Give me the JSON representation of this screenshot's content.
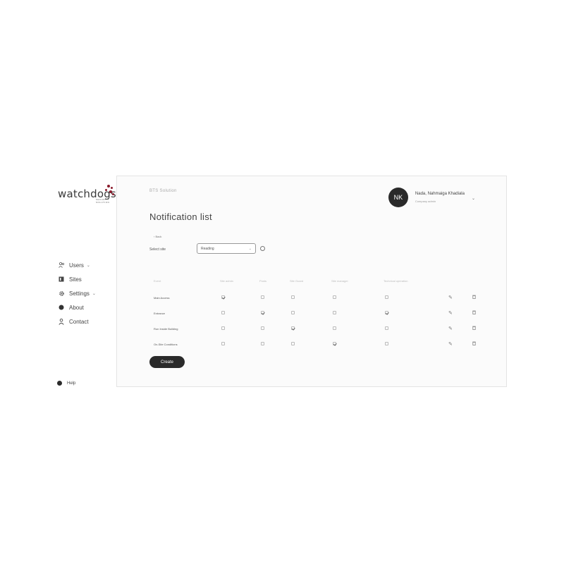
{
  "brand": {
    "logo_text": "watchdogs",
    "logo_sub": "SECURITY SOLUTION"
  },
  "sidebar": {
    "items": [
      {
        "label": "Users",
        "icon": "users-icon",
        "has_chevron": true
      },
      {
        "label": "Sites",
        "icon": "sites-icon",
        "has_chevron": false
      },
      {
        "label": "Settings",
        "icon": "gear-icon",
        "has_chevron": true
      },
      {
        "label": "About",
        "icon": "info-icon",
        "has_chevron": false
      },
      {
        "label": "Contact",
        "icon": "person-icon",
        "has_chevron": false
      }
    ],
    "help_label": "Help"
  },
  "header": {
    "breadcrumb": "BTS Solution",
    "title": "Notification list",
    "user": {
      "initials": "NK",
      "name": "Nada, Nahmaiga Khadiala",
      "role": "Company admin"
    }
  },
  "filters": {
    "back_label": "Back",
    "filter_label": "Select site",
    "select_value": "Reading"
  },
  "table": {
    "columns": [
      "Event",
      "Site admin",
      "Posts",
      "Site Guard",
      "Site manager",
      "Technical operation"
    ],
    "rows": [
      {
        "label": "Main Access",
        "checks": [
          true,
          false,
          false,
          false,
          false
        ]
      },
      {
        "label": "Entrance",
        "checks": [
          false,
          true,
          false,
          false,
          true
        ]
      },
      {
        "label": "Run Inside Building",
        "checks": [
          false,
          false,
          true,
          false,
          false
        ]
      },
      {
        "label": "On-Site Conditions",
        "checks": [
          false,
          false,
          false,
          true,
          false
        ]
      }
    ]
  },
  "create_label": "Create",
  "colors": {
    "accent": "#2a2a2a",
    "logo_accent": "#8b1c2c"
  }
}
